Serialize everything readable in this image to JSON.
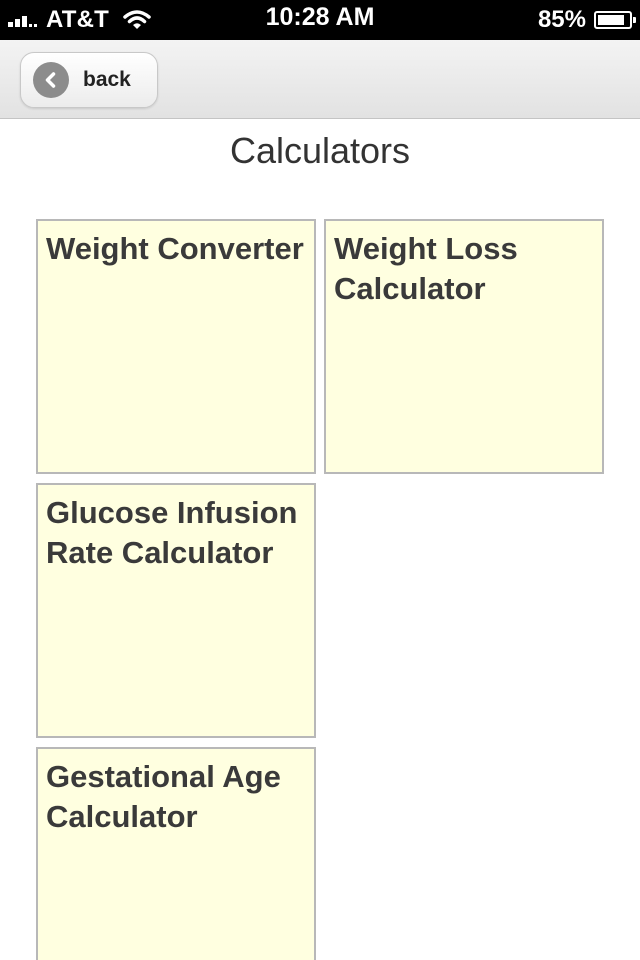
{
  "status_bar": {
    "carrier": "AT&T",
    "time": "10:28 AM",
    "battery_percent": "85%",
    "battery_level": 0.85
  },
  "nav": {
    "back_label": "back"
  },
  "page": {
    "title": "Calculators"
  },
  "tiles": [
    {
      "label": "Weight Converter"
    },
    {
      "label": "Weight Loss Calculator"
    },
    {
      "label": "Glucose Infusion Rate Calculator"
    },
    {
      "label": "Gestational Age Calculator"
    }
  ],
  "colors": {
    "tile_background": "#ffffe0",
    "tile_border": "#b8b8b8",
    "text": "#3a3a3a"
  }
}
